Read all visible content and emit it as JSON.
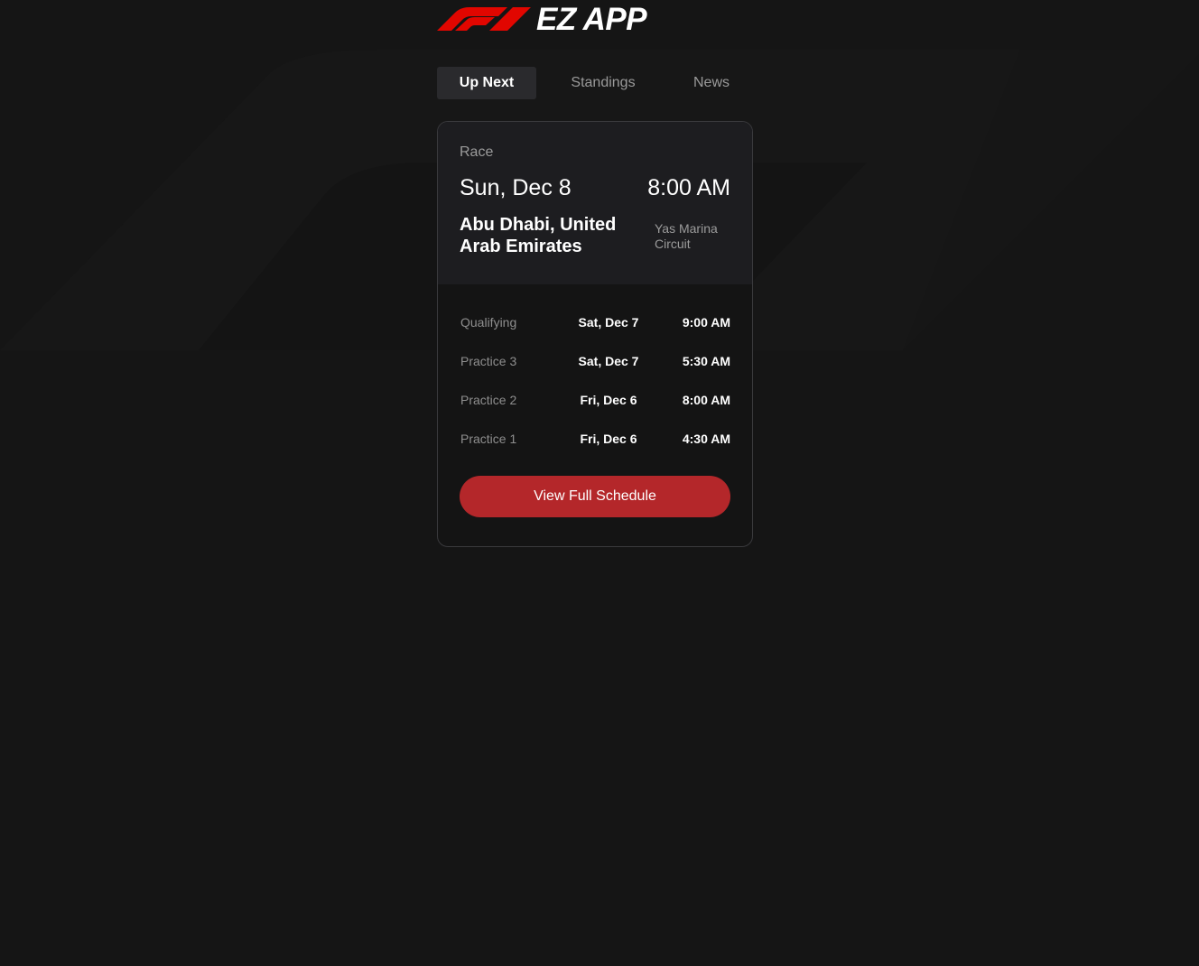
{
  "header": {
    "logo_icon": "f1-logo-icon",
    "title": "EZ APP"
  },
  "tabs": [
    {
      "label": "Up Next",
      "active": true
    },
    {
      "label": "Standings",
      "active": false
    },
    {
      "label": "News",
      "active": false
    }
  ],
  "next_race": {
    "label": "Race",
    "date": "Sun, Dec 8",
    "time": "8:00 AM",
    "location": "Abu Dhabi, United Arab Emirates",
    "circuit": "Yas Marina Circuit"
  },
  "sessions": [
    {
      "name": "Qualifying",
      "date": "Sat, Dec 7",
      "time": "9:00 AM"
    },
    {
      "name": "Practice 3",
      "date": "Sat, Dec 7",
      "time": "5:30 AM"
    },
    {
      "name": "Practice 2",
      "date": "Fri, Dec 6",
      "time": "8:00 AM"
    },
    {
      "name": "Practice 1",
      "date": "Fri, Dec 6",
      "time": "4:30 AM"
    }
  ],
  "actions": {
    "view_schedule_label": "View Full Schedule"
  },
  "colors": {
    "background": "#151515",
    "accent": "#b4272a",
    "logo_red": "#e10600",
    "card_top": "#1d1d20",
    "muted_text": "#9b9b9b"
  }
}
